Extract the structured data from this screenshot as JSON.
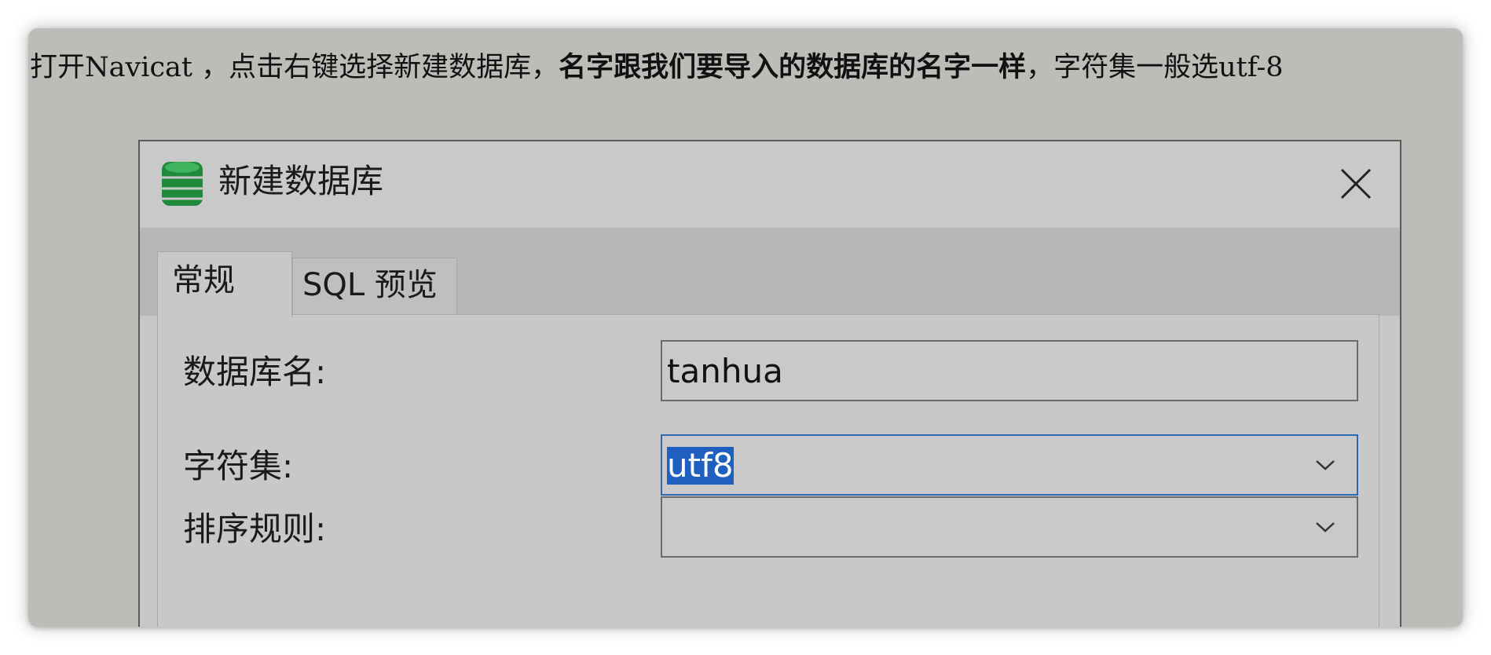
{
  "caption": {
    "part1": "打开Navicat ，点击右键选择新建数据库，",
    "part2": "名字跟我们要导入的数据库的名字一样",
    "part3": "，字符集一般选utf-8"
  },
  "dialog": {
    "title": "新建数据库",
    "icon": "database-icon",
    "close_icon": "close-icon",
    "tabs": [
      {
        "label": "常规",
        "active": true
      },
      {
        "label": "SQL 预览",
        "active": false
      }
    ],
    "fields": {
      "db_name": {
        "label": "数据库名:",
        "value": "tanhua"
      },
      "charset": {
        "label": "字符集:",
        "value": "utf8",
        "focused": true,
        "selected": true
      },
      "collation": {
        "label": "排序规则:",
        "value": ""
      }
    }
  },
  "colors": {
    "icon_green": "#1f8a3b",
    "selection_blue": "#1f5fbf",
    "focus_border": "#2f65b5"
  }
}
